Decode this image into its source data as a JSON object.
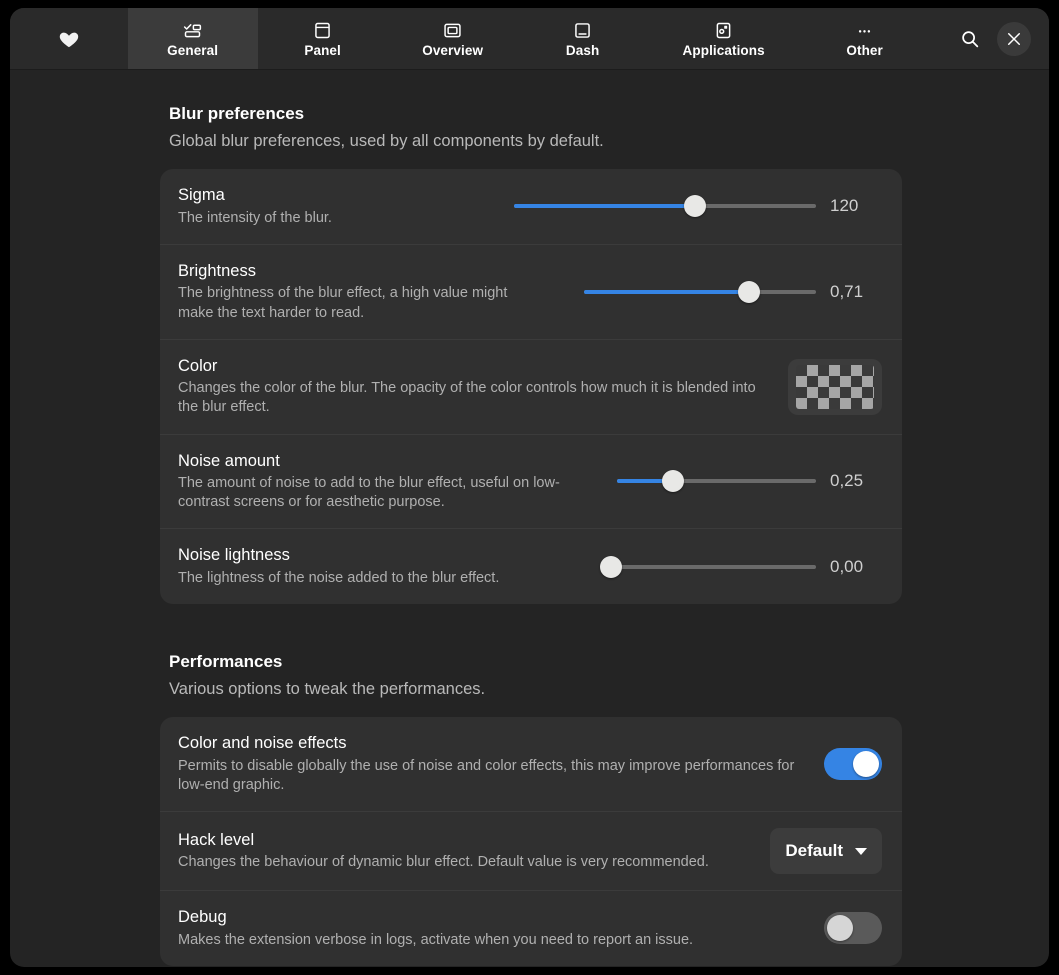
{
  "header": {
    "favorite_icon": "heart-icon",
    "search_icon": "search-icon",
    "close_icon": "close-icon",
    "tabs": [
      {
        "label": "General",
        "icon": "general-icon",
        "active": true
      },
      {
        "label": "Panel",
        "icon": "panel-icon",
        "active": false
      },
      {
        "label": "Overview",
        "icon": "overview-icon",
        "active": false
      },
      {
        "label": "Dash",
        "icon": "dash-icon",
        "active": false
      },
      {
        "label": "Applications",
        "icon": "applications-icon",
        "active": false
      },
      {
        "label": "Other",
        "icon": "ellipsis-icon",
        "active": false
      }
    ]
  },
  "colors": {
    "accent": "#3584e4",
    "window_bg": "#242424",
    "header_bg": "#2a2a2a",
    "card_bg": "#303030",
    "text": "#ffffff",
    "subtext": "#b0b0b0"
  },
  "sections": {
    "blur": {
      "title": "Blur preferences",
      "description": "Global blur preferences, used by all components by default.",
      "rows": {
        "sigma": {
          "title": "Sigma",
          "subtitle": "The intensity of the blur.",
          "value": "120",
          "percent": 60
        },
        "brightness": {
          "title": "Brightness",
          "subtitle": "The brightness of the blur effect, a high value might make the text harder to read.",
          "value": "0,71",
          "percent": 71
        },
        "color": {
          "title": "Color",
          "subtitle": "Changes the color of the blur. The opacity of the color controls how much it is blended into the blur effect.",
          "swatch": "transparent-checkerboard"
        },
        "noise_amount": {
          "title": "Noise amount",
          "subtitle": "The amount of noise to add to the blur effect, useful on low-contrast screens or for aesthetic purpose.",
          "value": "0,25",
          "percent": 25
        },
        "noise_lightness": {
          "title": "Noise lightness",
          "subtitle": "The lightness of the noise added to the blur effect.",
          "value": "0,00",
          "percent": 0
        }
      }
    },
    "performances": {
      "title": "Performances",
      "description": "Various options to tweak the performances.",
      "rows": {
        "color_noise_effects": {
          "title": "Color and noise effects",
          "subtitle": "Permits to disable globally the use of noise and color effects, this may improve performances for low-end graphic.",
          "toggle_state": "on"
        },
        "hack_level": {
          "title": "Hack level",
          "subtitle": "Changes the behaviour of dynamic blur effect. Default value is very recommended.",
          "selected": "Default"
        },
        "debug": {
          "title": "Debug",
          "subtitle": "Makes the extension verbose in logs, activate when you need to report an issue.",
          "toggle_state": "off"
        }
      }
    }
  }
}
